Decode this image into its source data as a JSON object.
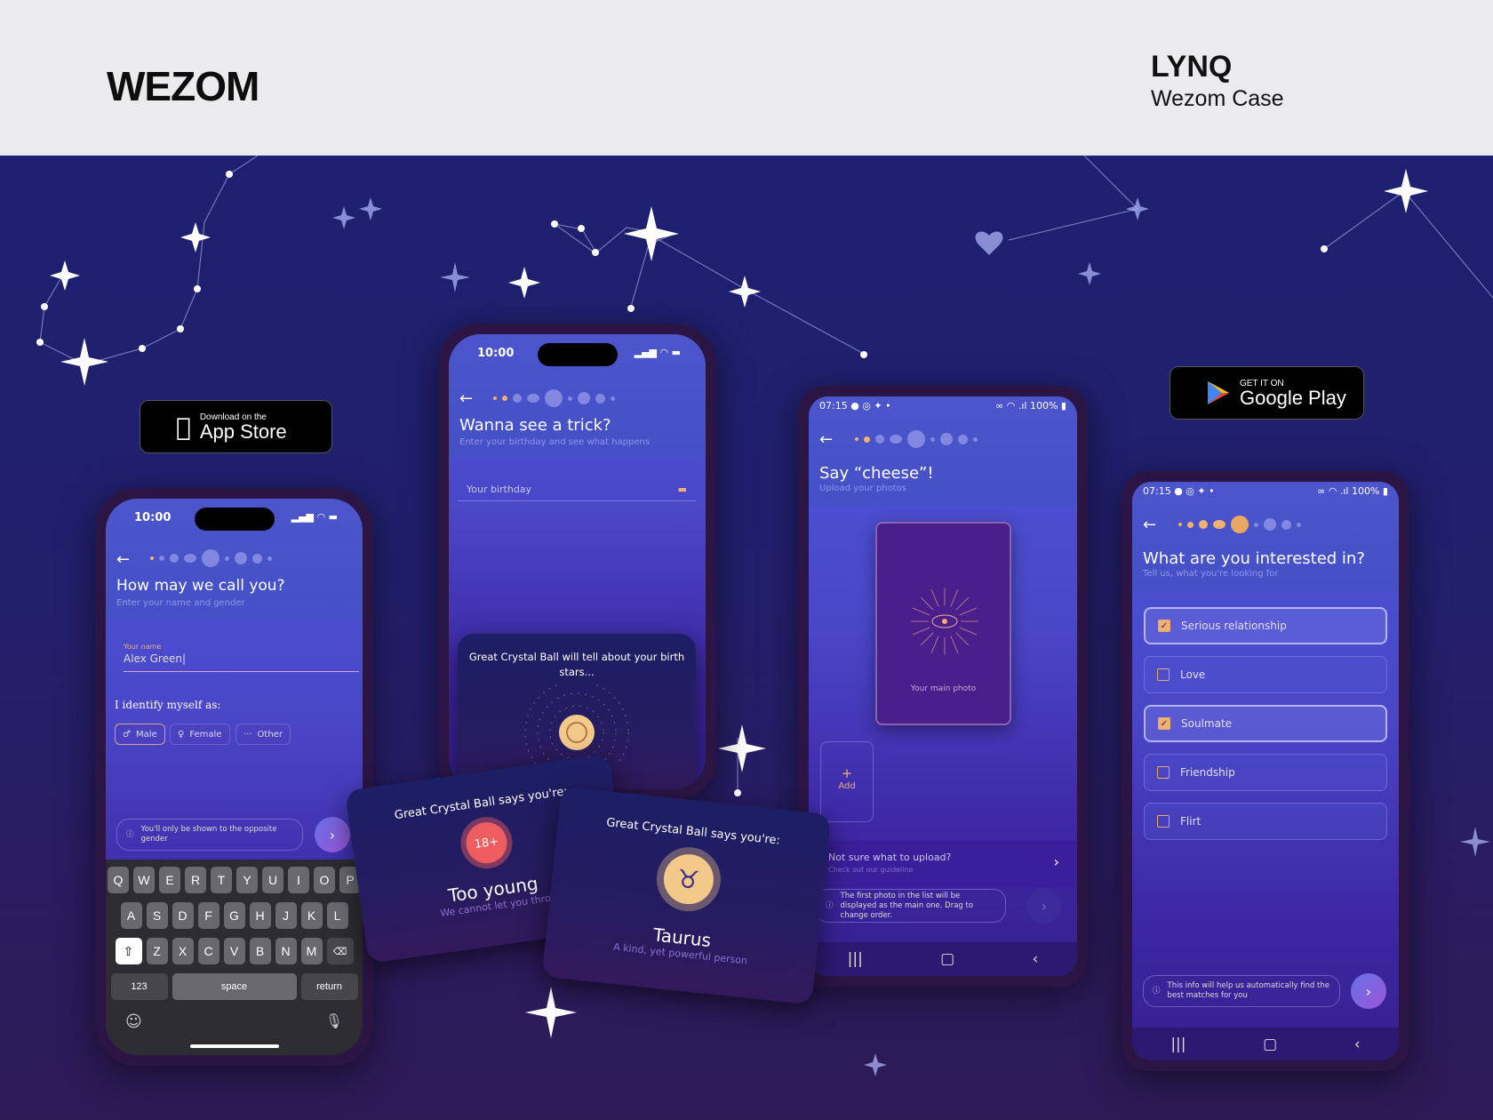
{
  "header": {
    "brand": "WEZOM",
    "project_title": "LYNQ",
    "project_subtitle": "Wezom Case"
  },
  "badges": {
    "app_store": {
      "small": "Download on the",
      "large": "App Store"
    },
    "google_play": {
      "small": "GET IT ON",
      "large": "Google Play"
    }
  },
  "phone_name": {
    "time": "10:00",
    "title": "How may we call you?",
    "subtitle": "Enter your name and gender",
    "name_label": "Your name",
    "name_value": "Alex Green",
    "identify_label": "I identify myself as:",
    "genders": [
      {
        "label": "Male",
        "icon": "male-icon",
        "selected": true
      },
      {
        "label": "Female",
        "icon": "female-icon",
        "selected": false
      },
      {
        "label": "Other",
        "icon": "more-icon",
        "selected": false
      }
    ],
    "info": "You'll only be shown to the opposite gender",
    "keyboard": {
      "row1": [
        "Q",
        "W",
        "E",
        "R",
        "T",
        "Y",
        "U",
        "I",
        "O",
        "P"
      ],
      "row2": [
        "A",
        "S",
        "D",
        "F",
        "G",
        "H",
        "J",
        "K",
        "L"
      ],
      "row3": [
        "Z",
        "X",
        "C",
        "V",
        "B",
        "N",
        "M"
      ],
      "numbers": "123",
      "space": "space",
      "return": "return"
    }
  },
  "phone_birthday": {
    "time": "10:00",
    "title": "Wanna see a trick?",
    "subtitle": "Enter your birthday and see what happens",
    "birthday_placeholder": "Your birthday",
    "crystal_text": "Great Crystal Ball will tell about your birth stars..."
  },
  "cards": [
    {
      "heading": "Great Crystal Ball says you're:",
      "badge": "18+",
      "result": "Too young",
      "detail": "We cannot let you thro"
    },
    {
      "heading": "Great Crystal Ball says you're:",
      "result": "Taurus",
      "detail": "A kind, yet powerful person"
    }
  ],
  "phone_photos": {
    "time": "07:15",
    "battery": "100%",
    "title": "Say “cheese”!",
    "subtitle": "Upload your photos",
    "main_photo": "Your main photo",
    "add_label": "Add",
    "guide_title": "Not sure what to upload?",
    "guide_sub": "Check out our guideline",
    "info": "The first photo in the list will be displayed as the main one. Drag to change order."
  },
  "phone_interests": {
    "time": "07:15",
    "battery": "100%",
    "title": "What are you interested in?",
    "subtitle": "Tell us, what you're looking for",
    "options": [
      {
        "label": "Serious relationship",
        "checked": true
      },
      {
        "label": "Love",
        "checked": false
      },
      {
        "label": "Soulmate",
        "checked": true
      },
      {
        "label": "Friendship",
        "checked": false
      },
      {
        "label": "Flirt",
        "checked": false
      }
    ],
    "info": "This info will help us automatically find the best matches for you"
  },
  "colors": {
    "header_bg": "#ebebed",
    "background": "#1d2070",
    "accent": "#f0b070",
    "screen": "#4b55d6"
  }
}
